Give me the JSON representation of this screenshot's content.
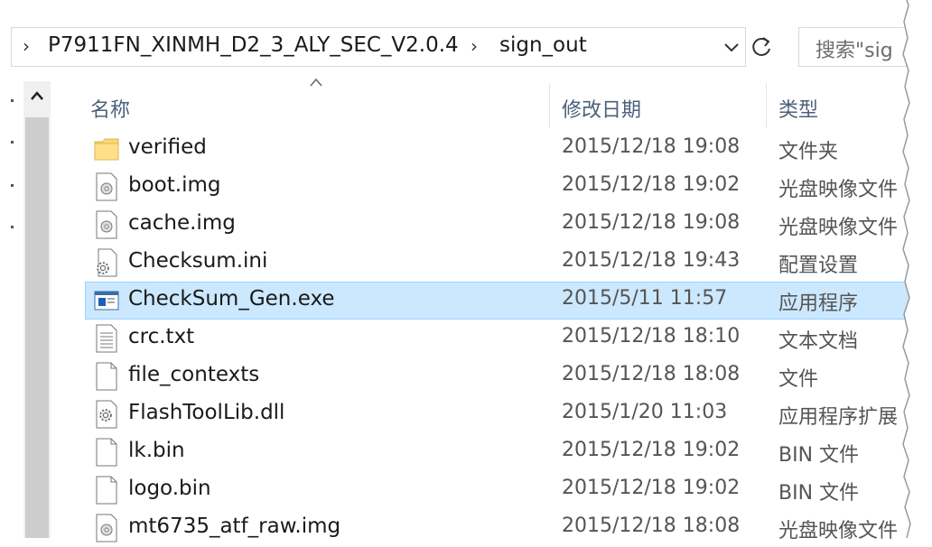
{
  "address_bar": {
    "breadcrumbs": [
      "P7911FN_XINMH_D2_3_ALY_SEC_V2.0.4",
      "sign_out"
    ]
  },
  "search": {
    "placeholder": "搜索\"sig"
  },
  "columns": {
    "name": "名称",
    "date": "修改日期",
    "type": "类型"
  },
  "files": [
    {
      "name": "verified",
      "date": "2015/12/18 19:08",
      "type": "文件夹",
      "icon": "folder-icon"
    },
    {
      "name": "boot.img",
      "date": "2015/12/18 19:02",
      "type": "光盘映像文件",
      "icon": "disc-image-icon"
    },
    {
      "name": "cache.img",
      "date": "2015/12/18 19:08",
      "type": "光盘映像文件",
      "icon": "disc-image-icon"
    },
    {
      "name": "Checksum.ini",
      "date": "2015/12/18 19:43",
      "type": "配置设置",
      "icon": "settings-file-icon"
    },
    {
      "name": "CheckSum_Gen.exe",
      "date": "2015/5/11 11:57",
      "type": "应用程序",
      "icon": "application-icon",
      "selected": true
    },
    {
      "name": "crc.txt",
      "date": "2015/12/18 18:10",
      "type": "文本文档",
      "icon": "text-file-icon"
    },
    {
      "name": "file_contexts",
      "date": "2015/12/18 18:08",
      "type": "文件",
      "icon": "blank-file-icon"
    },
    {
      "name": "FlashToolLib.dll",
      "date": "2015/1/20 11:03",
      "type": "应用程序扩展",
      "icon": "dll-file-icon"
    },
    {
      "name": "lk.bin",
      "date": "2015/12/18 19:02",
      "type": "BIN 文件",
      "icon": "blank-file-icon"
    },
    {
      "name": "logo.bin",
      "date": "2015/12/18 19:02",
      "type": "BIN 文件",
      "icon": "blank-file-icon"
    },
    {
      "name": "mt6735_atf_raw.img",
      "date": "2015/12/18 18:08",
      "type": "光盘映像文件",
      "icon": "disc-image-icon"
    }
  ],
  "colors": {
    "selection_bg": "#cce8ff",
    "selection_border": "#99d1ff",
    "header_text": "#4c607a"
  }
}
